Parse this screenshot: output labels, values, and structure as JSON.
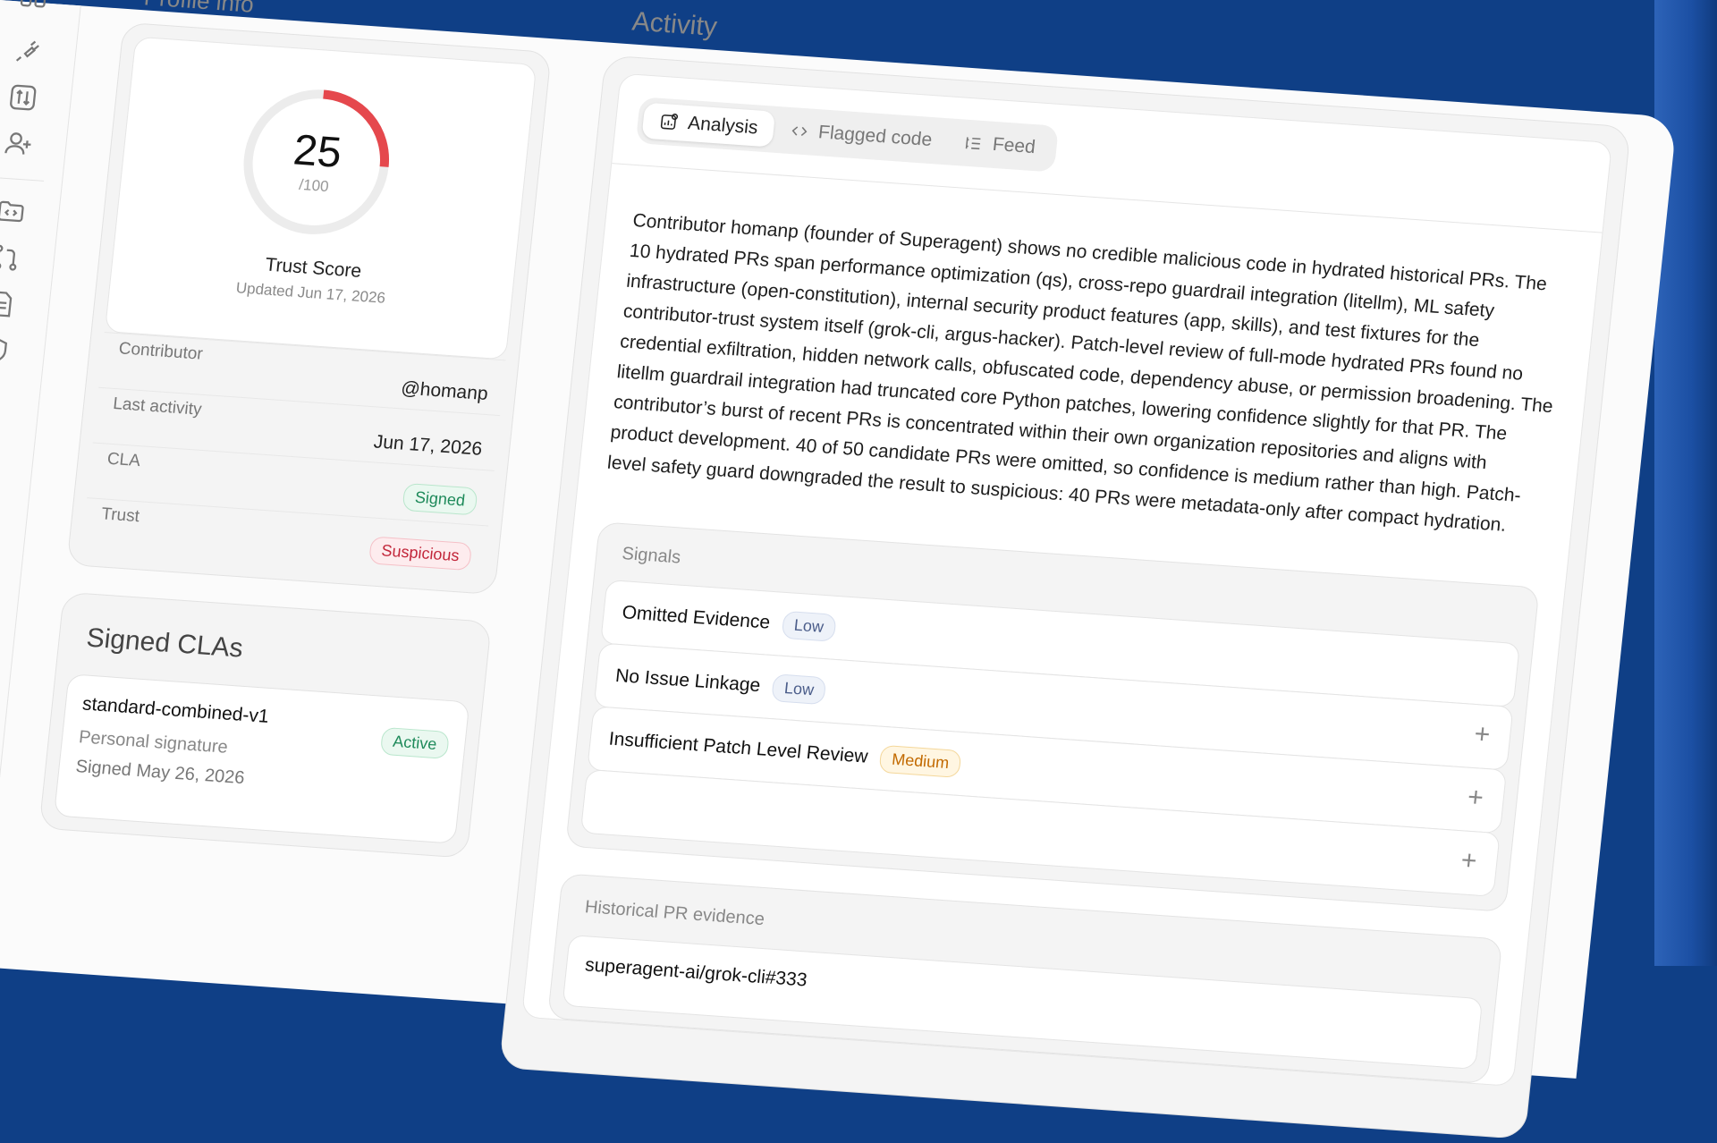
{
  "profile": {
    "section_title": "Profile info",
    "score": "25",
    "score_max": "/100",
    "score_fraction": 0.25,
    "score_label": "Trust Score",
    "updated": "Updated Jun 17, 2026",
    "rows": [
      {
        "key": "Contributor",
        "value": "@homanp"
      },
      {
        "key": "Last activity",
        "value": "Jun 17, 2026"
      },
      {
        "key": "CLA",
        "value": "Signed"
      },
      {
        "key": "Trust",
        "value": "Suspicious"
      }
    ]
  },
  "clas": {
    "title": "Signed CLAs",
    "items": [
      {
        "name": "standard-combined-v1",
        "type": "Personal signature",
        "date": "Signed May 26, 2026",
        "status": "Active"
      }
    ]
  },
  "activity": {
    "title": "Activity",
    "tabs": [
      {
        "label": "Analysis",
        "icon": "analysis-icon"
      },
      {
        "label": "Flagged code",
        "icon": "code-icon"
      },
      {
        "label": "Feed",
        "icon": "feed-icon"
      }
    ],
    "analysis_text": "Contributor homanp (founder of Superagent) shows no credible malicious code in hydrated historical PRs. The 10 hydrated PRs span performance optimization (qs), cross-repo guardrail integration (litellm), ML safety infrastructure (open-constitution), internal security product features (app, skills), and test fixtures for the contributor-trust system itself (grok-cli, argus-hacker). Patch-level review of full-mode hydrated PRs found no credential exfiltration, hidden network calls, obfuscated code, dependency abuse, or permission broadening. The litellm guardrail integration had truncated core Python patches, lowering confidence slightly for that PR. The contributor’s burst of recent PRs is concentrated within their own organization repositories and aligns with product development. 40 of 50 candidate PRs were omitted, so confidence is medium rather than high. Patch-level safety guard downgraded the result to suspicious: 40 PRs were metadata-only after compact hydration.",
    "signals_label": "Signals",
    "signals": [
      {
        "name": "Omitted Evidence",
        "level": "Low"
      },
      {
        "name": "No Issue Linkage",
        "level": "Low"
      },
      {
        "name": "Insufficient Patch Level Review",
        "level": "Medium"
      }
    ],
    "history_label": "Historical PR evidence",
    "history_first": "superagent-ai/grok-cli#333"
  },
  "colors": {
    "accent_red": "#e5484d",
    "gauge_track": "#ececec",
    "bg_edge": "#1b4fa3"
  }
}
